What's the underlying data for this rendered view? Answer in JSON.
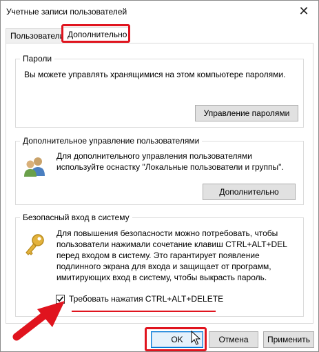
{
  "window": {
    "title": "Учетные записи пользователей",
    "close_glyph": "✕"
  },
  "tabs": [
    {
      "label": "Пользователи",
      "active": false
    },
    {
      "label": "Дополнительно",
      "active": true
    }
  ],
  "passwords": {
    "legend": "Пароли",
    "text": "Вы можете управлять хранящимися на этом компьютере паролями.",
    "button": "Управление паролями"
  },
  "advanced": {
    "legend": "Дополнительное управление пользователями",
    "text_line1": "Для дополнительного управления пользователями",
    "text_line2": "используйте оснастку \"Локальные пользователи и группы\".",
    "button": "Дополнительно",
    "icon": "users-icon"
  },
  "secure_logon": {
    "legend": "Безопасный вход в систему",
    "lines": [
      "Для повышения безопасности можно потребовать, чтобы",
      "пользователи нажимали сочетание клавиш CTRL+ALT+DEL",
      "перед входом в систему. Это гарантирует появление",
      "подлинного экрана для входа и защищает от программ,",
      "имитирующих вход в систему, чтобы выкрасть пароль."
    ],
    "checkbox_label": "Требовать нажатия CTRL+ALT+DELETE",
    "checkbox_checked": true,
    "icon": "key-icon"
  },
  "footer": {
    "ok": "OK",
    "cancel": "Отмена",
    "apply": "Применить"
  },
  "colors": {
    "annotation": "#e0141e",
    "focus": "#0078d7"
  }
}
